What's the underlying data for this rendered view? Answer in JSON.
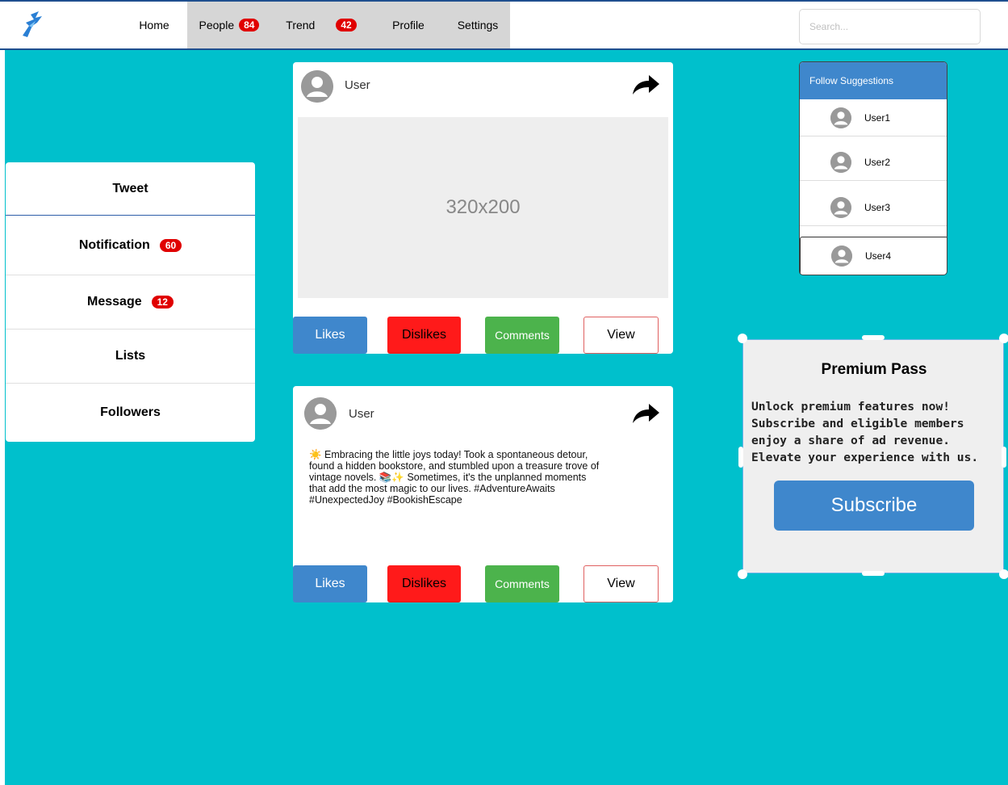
{
  "nav": {
    "home": "Home",
    "people": "People",
    "people_badge": "84",
    "trend": "Trend",
    "trend_badge": "42",
    "profile": "Profile",
    "settings": "Settings",
    "search_placeholder": "Search..."
  },
  "menu": {
    "tweet": "Tweet",
    "notification": "Notification",
    "notification_badge": "60",
    "message": "Message",
    "message_badge": "12",
    "lists": "Lists",
    "followers": "Followers"
  },
  "posts": [
    {
      "user": "User",
      "image_placeholder": "320x200",
      "likes": "Likes",
      "dislikes": "Dislikes",
      "comments": "Comments",
      "view": "View"
    },
    {
      "user": "User",
      "text": "☀️ Embracing the little joys today! Took a spontaneous detour, found a hidden bookstore, and stumbled upon a treasure trove of vintage novels. 📚✨ Sometimes, it's the unplanned moments that add the most magic to our lives. #AdventureAwaits #UnexpectedJoy #BookishEscape",
      "likes": "Likes",
      "dislikes": "Dislikes",
      "comments": "Comments",
      "view": "View"
    }
  ],
  "follow": {
    "title": "Follow Suggestions",
    "users": [
      "User1",
      "User2",
      "User3",
      "User4"
    ]
  },
  "premium": {
    "title": "Premium Pass",
    "text": "Unlock premium features now! Subscribe and eligible members enjoy a share of ad revenue. Elevate your experience with us.",
    "button": "Subscribe"
  },
  "colors": {
    "background": "#00c0cc",
    "primary": "#3f87cc",
    "danger": "#ff1a1a",
    "success": "#4cb34c",
    "badge": "#e00000"
  }
}
